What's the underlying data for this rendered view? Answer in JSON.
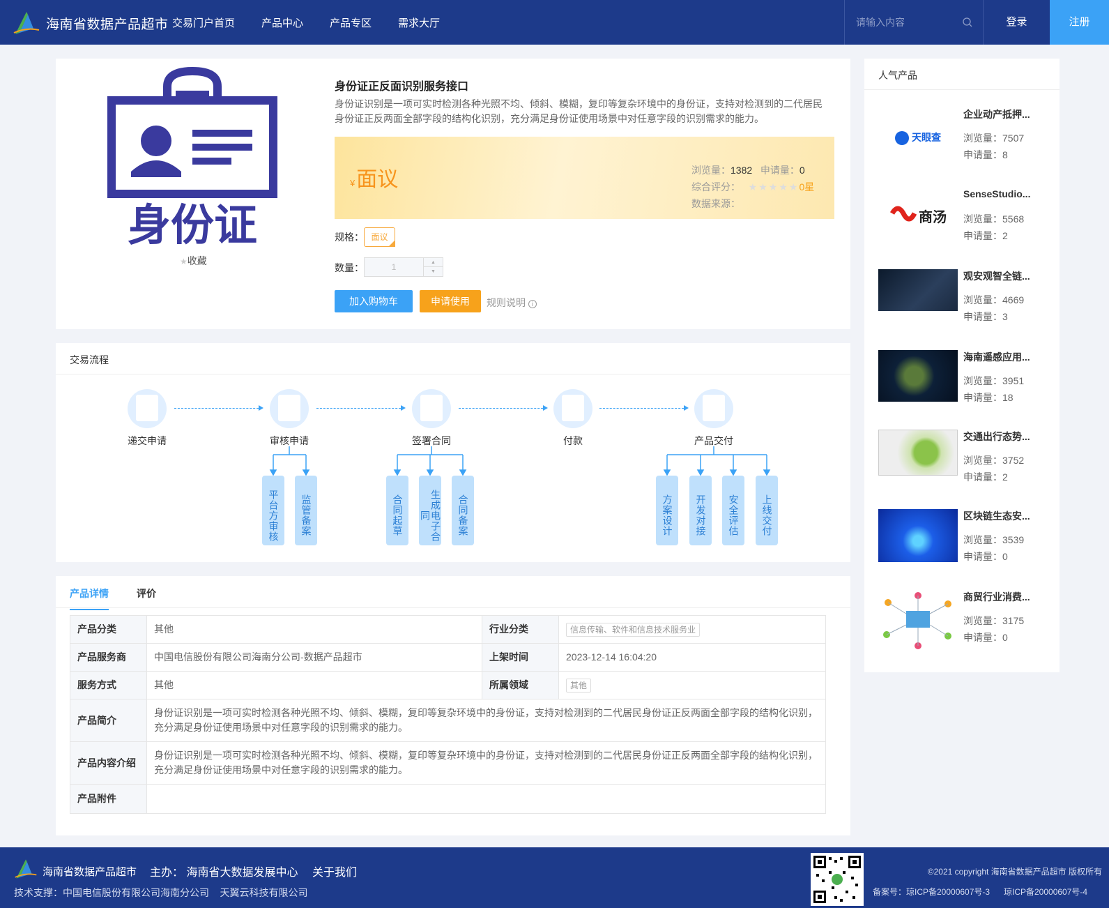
{
  "header": {
    "brand": "海南省数据产品超市",
    "nav": [
      "交易门户首页",
      "产品中心",
      "产品专区",
      "需求大厅"
    ],
    "search_placeholder": "请输入内容",
    "login": "登录",
    "register": "注册"
  },
  "product": {
    "image_text": "身份证",
    "favorite": "收藏",
    "title": "身份证正反面识别服务接口",
    "desc": "身份证识别是一项可实时检测各种光照不均、倾斜、模糊，复印等复杂环境中的身份证，支持对检测到的二代居民身份证正反两面全部字段的结构化识别，充分满足身份证使用场景中对任意字段的识别需求的能力。",
    "currency": "¥",
    "price": "面议",
    "views_label": "浏览量：",
    "views": "1382",
    "applies_label": "申请量：",
    "applies": "0",
    "rating_label": "综合评分：",
    "rating": "0星",
    "rating_stars": 0,
    "source_label": "数据来源：",
    "spec_label": "规格：",
    "spec": "面议",
    "qty_label": "数量：",
    "qty": "1",
    "add_cart": "加入购物车",
    "apply": "申请使用",
    "rules": "规则说明"
  },
  "flow": {
    "title": "交易流程",
    "steps": [
      "递交申请",
      "审核申请",
      "签署合同",
      "付款",
      "产品交付"
    ],
    "subs": {
      "review": [
        "平台方审核",
        "监管备案"
      ],
      "contract": [
        "合同起草",
        "生成电子合同",
        "合同备案"
      ],
      "deliver": [
        "方案设计",
        "开发对接",
        "安全评估",
        "上线交付"
      ]
    }
  },
  "details": {
    "tabs": [
      "产品详情",
      "评价"
    ],
    "rows": {
      "category_k": "产品分类",
      "category_v": "其他",
      "industry_k": "行业分类",
      "industry_v": "信息传输、软件和信息技术服务业",
      "provider_k": "产品服务商",
      "provider_v": "中国电信股份有限公司海南分公司-数据产品超市",
      "time_k": "上架时间",
      "time_v": "2023-12-14 16:04:20",
      "mode_k": "服务方式",
      "mode_v": "其他",
      "field_k": "所属领域",
      "field_v": "其他",
      "intro_k": "产品简介",
      "intro_v": "身份证识别是一项可实时检测各种光照不均、倾斜、模糊，复印等复杂环境中的身份证，支持对检测到的二代居民身份证正反两面全部字段的结构化识别，充分满足身份证使用场景中对任意字段的识别需求的能力。",
      "content_k": "产品内容介绍",
      "content_v": "身份证识别是一项可实时检测各种光照不均、倾斜、模糊，复印等复杂环境中的身份证，支持对检测到的二代居民身份证正反两面全部字段的结构化识别，充分满足身份证使用场景中对任意字段的识别需求的能力。",
      "attach_k": "产品附件"
    }
  },
  "sidebar": {
    "title": "人气产品",
    "views_label": "浏览量：",
    "applies_label": "申请量：",
    "items": [
      {
        "name": "企业动产抵押...",
        "views": "7507",
        "applies": "8",
        "logo": "天眼查"
      },
      {
        "name": "SenseStudio...",
        "views": "5568",
        "applies": "2",
        "logo": "商汤"
      },
      {
        "name": "观安观智全链...",
        "views": "4669",
        "applies": "3"
      },
      {
        "name": "海南遥感应用...",
        "views": "3951",
        "applies": "18"
      },
      {
        "name": "交通出行态势...",
        "views": "3752",
        "applies": "2"
      },
      {
        "name": "区块链生态安...",
        "views": "3539",
        "applies": "0"
      },
      {
        "name": "商贸行业消费...",
        "views": "3175",
        "applies": "0"
      }
    ]
  },
  "footer": {
    "brand": "海南省数据产品超市",
    "host": "主办： 海南省大数据发展中心",
    "about": "关于我们",
    "tech": "技术支撑：中国电信股份有限公司海南分公司    天翼云科技有限公司",
    "copyright": "©2021 copyright 海南省数据产品超市 版权所有",
    "icp1": "备案号：琼ICP备20000607号-3",
    "icp2": "琼ICP备20000607号-4"
  },
  "colors": {
    "header": "#1d3a8a",
    "accent": "#3ba2f6",
    "orange": "#f7a21b",
    "price": "#f7941d"
  }
}
